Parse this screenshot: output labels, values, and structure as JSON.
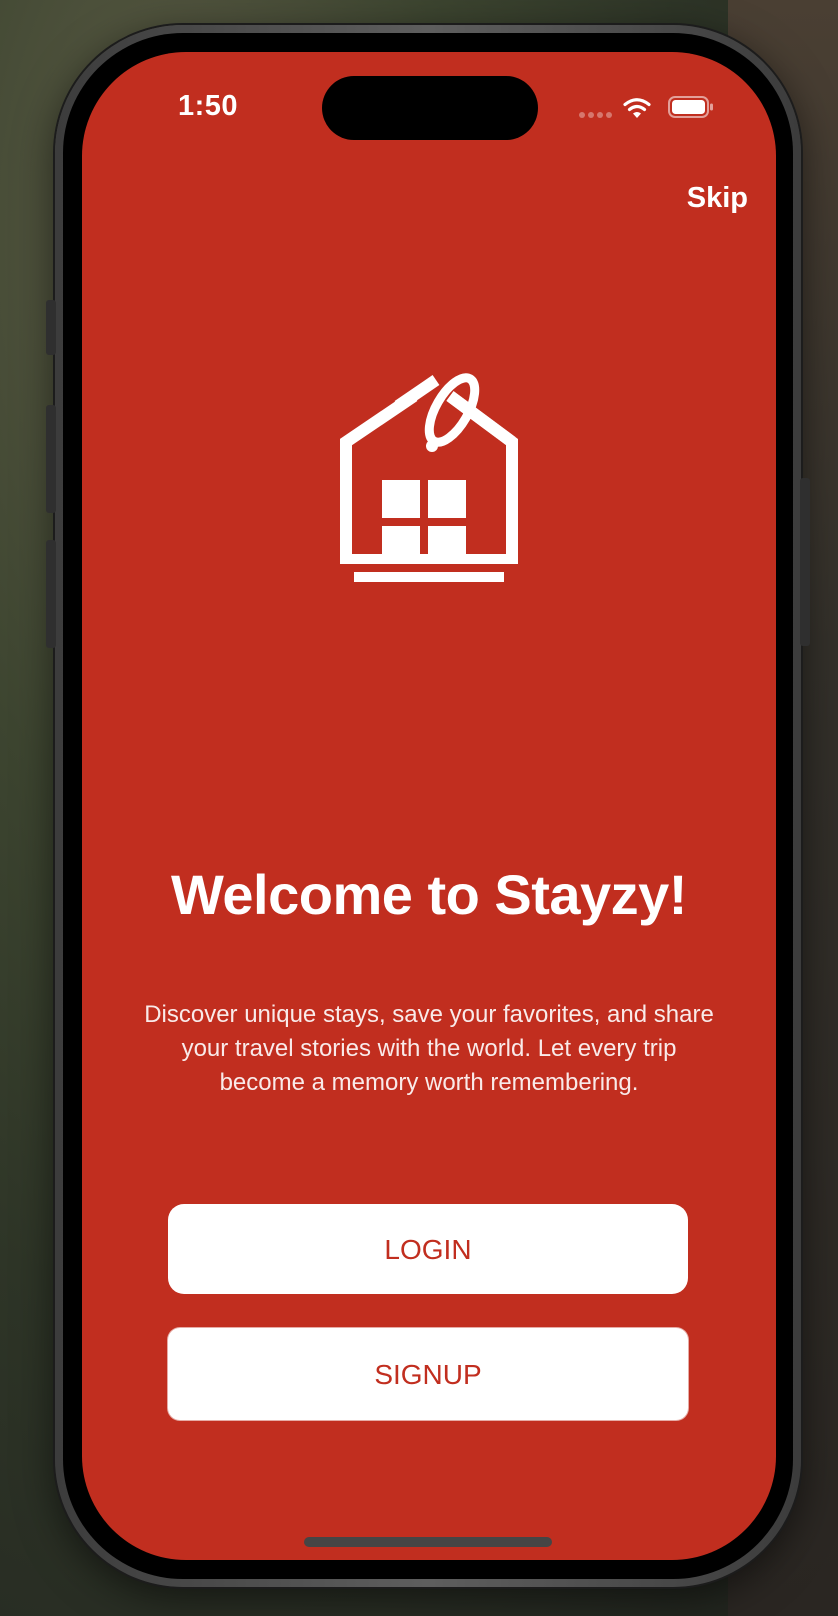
{
  "status_bar": {
    "time": "1:50",
    "wifi_icon": "wifi-icon",
    "battery_icon": "battery-icon"
  },
  "header": {
    "skip_label": "Skip"
  },
  "logo": {
    "icon": "house-tag-icon"
  },
  "main": {
    "title": "Welcome to Stayzy!",
    "description": "Discover unique stays, save your favorites, and share your travel stories with the world. Let every trip become a memory worth remembering."
  },
  "actions": {
    "login_label": "LOGIN",
    "signup_label": "SIGNUP"
  },
  "colors": {
    "brand_red": "#c12e1f",
    "button_bg": "#ffffff",
    "text_light": "#ffffff"
  }
}
